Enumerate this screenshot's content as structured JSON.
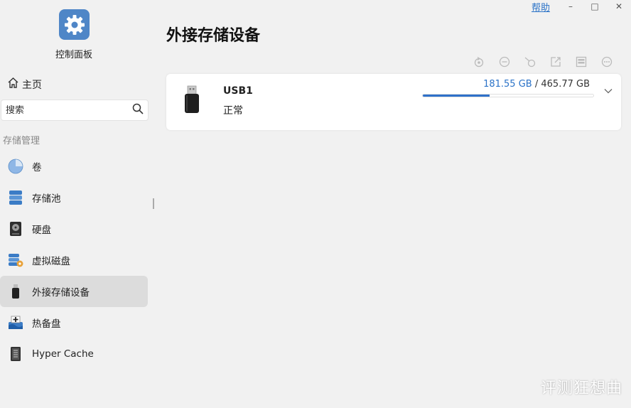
{
  "app": {
    "icon": "gear-icon",
    "title": "控制面板",
    "accent_color": "#2f71c9"
  },
  "window": {
    "help_label": "帮助",
    "minimize_glyph": "–",
    "maximize_glyph": "□",
    "close_glyph": "✕"
  },
  "sidebar": {
    "home_label": "主页",
    "search_placeholder": "搜索",
    "section_title": "存储管理",
    "items": [
      {
        "label": "卷",
        "icon": "volume-pie-icon",
        "active": false
      },
      {
        "label": "存储池",
        "icon": "storage-pool-icon",
        "active": false
      },
      {
        "label": "硬盘",
        "icon": "hard-disk-icon",
        "active": false
      },
      {
        "label": "虚拟磁盘",
        "icon": "virtual-disk-icon",
        "active": false
      },
      {
        "label": "外接存储设备",
        "icon": "usb-drive-icon",
        "active": true
      },
      {
        "label": "热备盘",
        "icon": "hot-spare-icon",
        "active": false
      },
      {
        "label": "Hyper Cache",
        "icon": "hyper-cache-icon",
        "active": false
      }
    ]
  },
  "main": {
    "page_title": "外接存储设备",
    "toolbar_icons": [
      "refresh-icon",
      "eject-icon",
      "unmount-icon",
      "export-icon",
      "format-icon",
      "more-icon"
    ],
    "device": {
      "name": "USB1",
      "status": "正常",
      "used": "181.55 GB",
      "separator": "/",
      "total": "465.77 GB",
      "used_fraction": 0.39
    }
  },
  "watermark": "评测狂想曲"
}
